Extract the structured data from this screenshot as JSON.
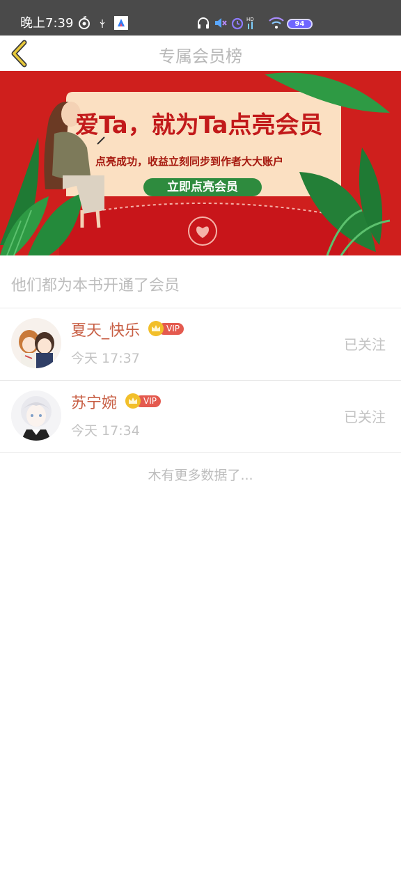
{
  "status_bar": {
    "time": "晚上7:39",
    "battery": "94",
    "icons": [
      "netease-music-icon",
      "usb-icon",
      "app-icon",
      "headphones-icon",
      "mute-icon",
      "alarm-icon",
      "hd-signal-icon",
      "wifi-icon",
      "battery-icon"
    ]
  },
  "nav": {
    "title": "专属会员榜",
    "back_icon": "chevron-left-icon"
  },
  "banner": {
    "headline": "爱Ta，就为Ta点亮会员",
    "subline": "点亮成功，收益立刻同步到作者大大账户",
    "cta": "立即点亮会员",
    "colors": {
      "background": "#cf1f1d",
      "card": "#fbe0c2",
      "cta": "#2e8b3e"
    }
  },
  "section": {
    "title": "他们都为本书开通了会员"
  },
  "members": [
    {
      "name": "夏天_快乐",
      "vip": "VIP",
      "time": "今天 17:37",
      "follow": "已关注"
    },
    {
      "name": "苏宁婉",
      "vip": "VIP",
      "time": "今天 17:34",
      "follow": "已关注"
    }
  ],
  "footer": {
    "no_more": "木有更多数据了..."
  },
  "colors": {
    "name": "#c85f45",
    "vip_pill": "#e45a4f",
    "crown": "#f2bf2a",
    "back_arrow": "#e8c93a"
  }
}
